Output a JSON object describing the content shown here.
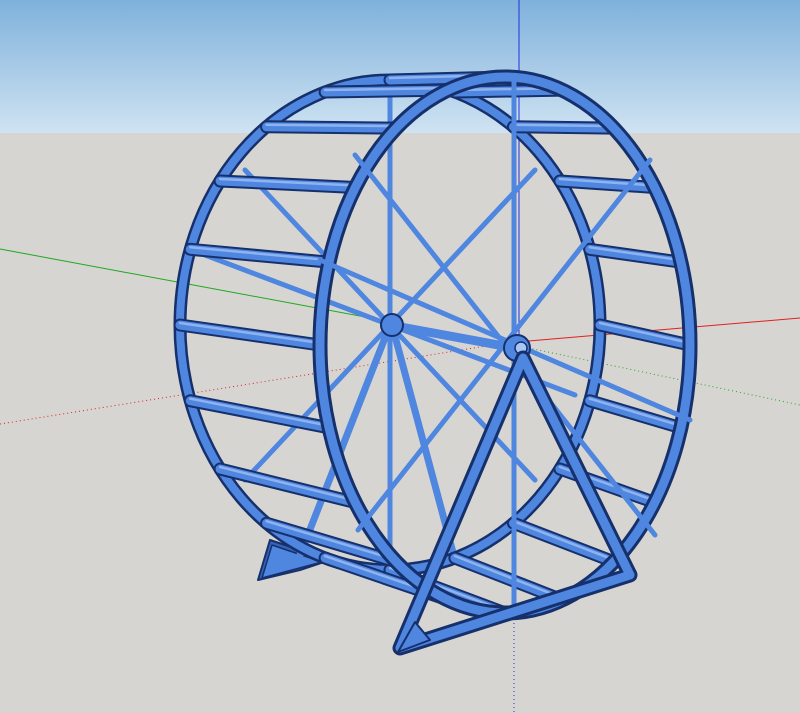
{
  "viewport": {
    "sky_top_color": "#7fb1dc",
    "sky_bottom_color": "#cfe3f2",
    "ground_color": "#d6d5d1",
    "axis_colors": {
      "red": "#e02020",
      "green": "#1fa81f",
      "blue": "#2030e0"
    }
  },
  "model": {
    "object": "hamster-wheel",
    "material_color": "#4f86e0",
    "outline_color": "#16306c",
    "rung_count": 20,
    "spoke_count": 4
  }
}
